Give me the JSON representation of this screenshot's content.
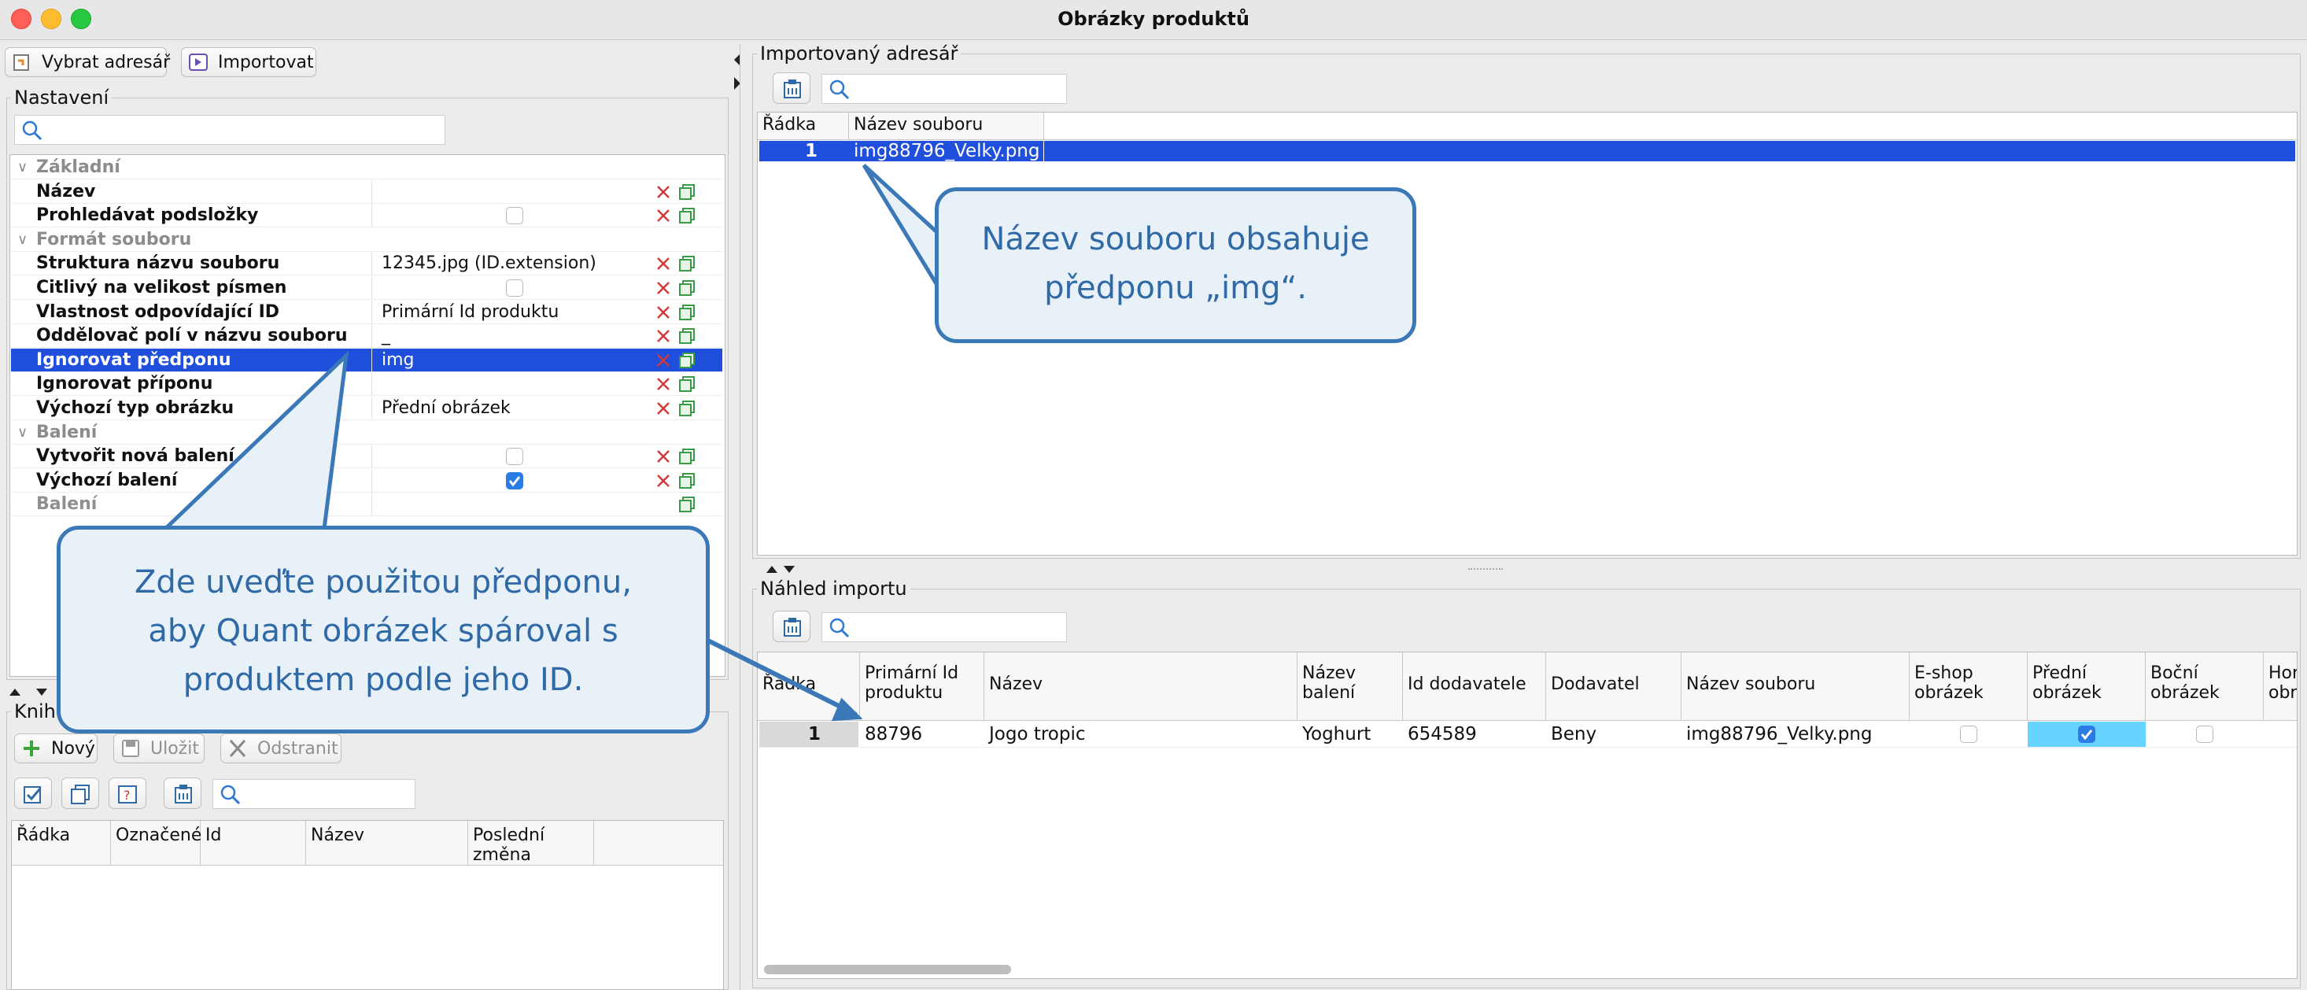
{
  "window": {
    "title": "Obrázky produktů"
  },
  "toolbar": {
    "select_dir": "Vybrat adresář",
    "import": "Importovat"
  },
  "settings": {
    "title": "Nastavení",
    "rows": [
      {
        "label": "Základní",
        "value": "",
        "type": "category"
      },
      {
        "label": "Název",
        "value": "",
        "type": "text"
      },
      {
        "label": "Prohledávat podsložky",
        "value": "",
        "type": "checkbox",
        "checked": false
      },
      {
        "label": "Formát souboru",
        "value": "",
        "type": "category"
      },
      {
        "label": "Struktura názvu souboru",
        "value": "12345.jpg (ID.extension)",
        "type": "text"
      },
      {
        "label": "Citlivý na velikost písmen",
        "value": "",
        "type": "checkbox",
        "checked": false
      },
      {
        "label": "Vlastnost odpovídající ID",
        "value": "Primární Id produktu",
        "type": "text"
      },
      {
        "label": "Oddělovač polí v názvu souboru",
        "value": "_",
        "type": "text"
      },
      {
        "label": "Ignorovat předponu",
        "value": "img",
        "type": "text",
        "selected": true
      },
      {
        "label": "Ignorovat příponu",
        "value": "",
        "type": "text"
      },
      {
        "label": "Výchozí typ obrázku",
        "value": "Přední obrázek",
        "type": "text"
      },
      {
        "label": "Balení",
        "value": "",
        "type": "category"
      },
      {
        "label": "Vytvořit nová balení",
        "value": "",
        "type": "checkbox",
        "checked": false
      },
      {
        "label": "Výchozí balení",
        "value": "",
        "type": "checkbox",
        "checked": true
      },
      {
        "label": "Balení",
        "value": "",
        "type": "disabled"
      }
    ]
  },
  "library": {
    "title": "Knihovna",
    "new_btn": "Nový",
    "save_btn": "Uložit",
    "remove_btn": "Odstranit",
    "columns": [
      "Řádka",
      "Označené",
      "Id",
      "Název",
      "Poslední změna"
    ]
  },
  "imported_dir": {
    "title": "Importovaný adresář",
    "columns": [
      "Řádka",
      "Název souboru"
    ],
    "rows": [
      {
        "row": "1",
        "filename": "img88796_Velky.png"
      }
    ]
  },
  "preview": {
    "title": "Náhled importu",
    "columns": [
      "Řádka",
      "Primární Id produktu",
      "Název",
      "Název balení",
      "Id dodavatele",
      "Dodavatel",
      "Název souboru",
      "E-shop obrázek",
      "Přední obrázek",
      "Boční obrázek",
      "Hor obr"
    ],
    "row": {
      "row": "1",
      "id": "88796",
      "name": "Jogo tropic",
      "package": "Yoghurt",
      "supplier_id": "654589",
      "supplier": "Beny",
      "filename": "img88796_Velky.png",
      "eshop": false,
      "front": true,
      "side": false
    }
  },
  "callouts": {
    "prefix_line1": "Zde uveďte použitou předponu,",
    "prefix_line2": "aby Quant obrázek spároval s",
    "prefix_line3": "produktem podle jeho ID.",
    "filename_line1": "Název souboru obsahuje",
    "filename_line2": "předponu „img“."
  },
  "colors": {
    "selection": "#1f4fdb",
    "callout_border": "#3a78b8",
    "callout_fill": "#e8f0f8",
    "front_cell": "#66d4ff"
  }
}
